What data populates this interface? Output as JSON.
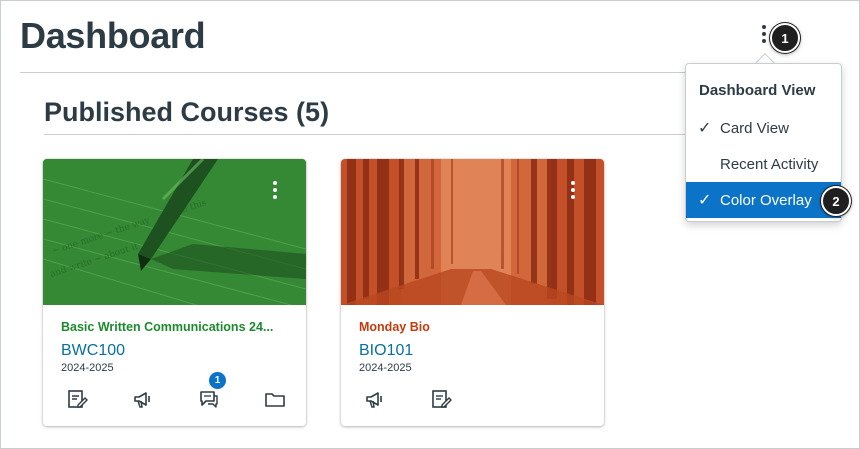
{
  "header": {
    "title": "Dashboard"
  },
  "callouts": [
    "1",
    "2"
  ],
  "section": {
    "title": "Published Courses (5)"
  },
  "dashboard_menu": {
    "heading": "Dashboard View",
    "items": [
      {
        "label": "Card View",
        "checked": true,
        "highlighted": false
      },
      {
        "label": "Recent Activity",
        "checked": false,
        "highlighted": false
      },
      {
        "label": "Color Overlay",
        "checked": true,
        "highlighted": true
      }
    ],
    "check_glyph": "✓"
  },
  "courses": [
    {
      "name": "Basic Written Communications 24...",
      "code": "BWC100",
      "term": "2024-2025",
      "color": "#1e8a2e",
      "hero_image": "pen-writing-on-paper",
      "icons": [
        "assignments-icon",
        "announcements-icon",
        "discussions-icon",
        "files-icon"
      ],
      "discussions_unread": "1"
    },
    {
      "name": "Monday Bio",
      "code": "BIO101",
      "term": "2024-2025",
      "color": "#c23c0d",
      "hero_image": "forest-path",
      "icons": [
        "announcements-icon",
        "assignments-icon"
      ]
    }
  ],
  "colors": {
    "text": "#2d3b45",
    "link": "#0770a3",
    "accent": "#0b74c8",
    "border": "#c7cdd1"
  }
}
